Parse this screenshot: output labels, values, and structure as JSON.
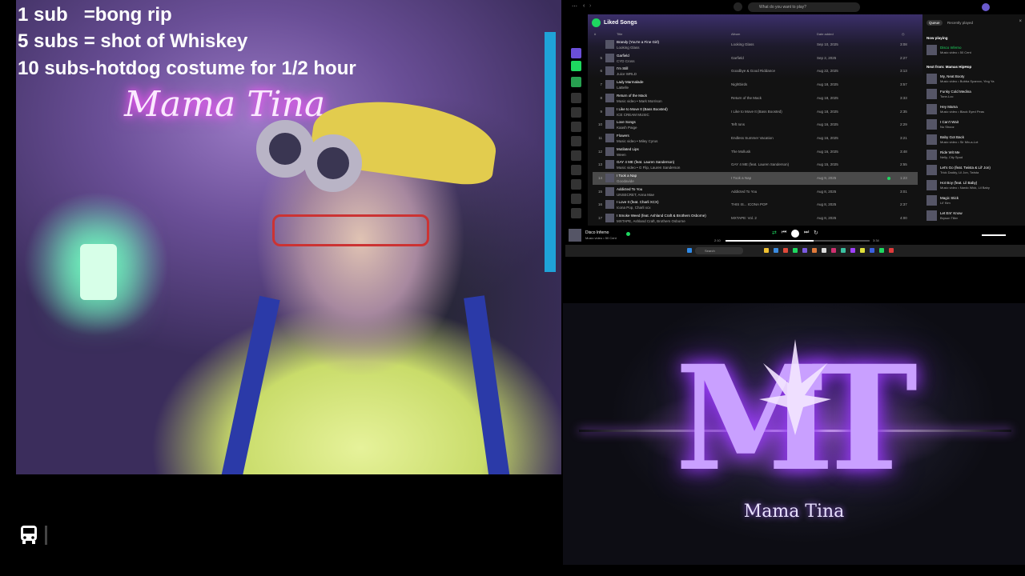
{
  "overlay": {
    "lines": [
      "1 sub   =bong rip",
      "5 subs = shot of Whiskey",
      "10 subs-hotdog costume for 1/2 hour"
    ]
  },
  "webcam": {
    "neon_sign": "Mama Tina"
  },
  "spotify": {
    "search_placeholder": "What do you want to play?",
    "playlist_title": "Liked Songs",
    "columns": {
      "num": "#",
      "title": "Title",
      "album": "Album",
      "date": "Date added"
    },
    "rows": [
      {
        "n": "",
        "title": "Brandy (You're a Fine Girl)",
        "artist": "Looking Glass",
        "album": "Looking Glass",
        "date": "Sep 10, 2025",
        "dur": "3:08"
      },
      {
        "n": "5",
        "title": "Garfield",
        "artist": "CYD Cross",
        "album": "Garfield",
        "date": "Sep 2, 2025",
        "dur": "2:27"
      },
      {
        "n": "6",
        "title": "I'm Still",
        "artist": "Juice WRLD",
        "album": "Goodbye & Good Riddance",
        "date": "Aug 22, 2025",
        "dur": "3:13"
      },
      {
        "n": "7",
        "title": "Lady Marmalade",
        "artist": "LaBelle",
        "album": "Nightbirds",
        "date": "Aug 18, 2025",
        "dur": "3:57"
      },
      {
        "n": "8",
        "title": "Return of the Mack",
        "artist": "Music video • Mark Morrison",
        "album": "Return of the Mack",
        "date": "Aug 18, 2025",
        "dur": "3:33"
      },
      {
        "n": "9",
        "title": "I Like to Move It (Bass Boosted)",
        "artist": "ICE CREAM MUSIC",
        "album": "I Like to Move It (Bass Boosted)",
        "date": "Aug 18, 2025",
        "dur": "2:35"
      },
      {
        "n": "10",
        "title": "Love Songs",
        "artist": "Kaash Paige",
        "album": "Teft Ions",
        "date": "Aug 16, 2025",
        "dur": "2:29"
      },
      {
        "n": "11",
        "title": "Flowers",
        "artist": "Music video • Miley Cyrus",
        "album": "Endless Summer Vacation",
        "date": "Aug 16, 2025",
        "dur": "3:21"
      },
      {
        "n": "12",
        "title": "Mutilated Lips",
        "artist": "Ween",
        "album": "The Mollusk",
        "date": "Aug 16, 2025",
        "dur": "3:48"
      },
      {
        "n": "13",
        "title": "GAY 4 ME (feat. Lauren Sanderson)",
        "artist": "Music video • G Flip, Lauren Sanderson",
        "album": "GAY 4 ME (feat. Lauren Sanderson)",
        "date": "Aug 15, 2025",
        "dur": "2:55"
      },
      {
        "n": "14",
        "title": "I Took a Nap",
        "artist": "Goodavide",
        "album": "I Took a Nap",
        "date": "Aug 9, 2025",
        "dur": "1:23"
      },
      {
        "n": "15",
        "title": "Addicted To You",
        "artist": "UNSECRET, Anna Mae",
        "album": "Addicted To You",
        "date": "Aug 8, 2025",
        "dur": "3:01"
      },
      {
        "n": "16",
        "title": "I Love It (feat. Charli XCX)",
        "artist": "Icona Pop, Charli xcx",
        "album": "THIS IS... ICONA POP",
        "date": "Aug 8, 2025",
        "dur": "2:37"
      },
      {
        "n": "17",
        "title": "I Smoke Weed (feat. Ashland Craft & Brothers Osborne)",
        "artist": "MXTAPE, Ashland Craft, Brothers Osborne",
        "album": "MXTAPE: Vol. 2",
        "date": "Aug 8, 2025",
        "dur": "4:00"
      }
    ],
    "queue": {
      "tabs": [
        "Queue",
        "Recently played"
      ],
      "now_playing_label": "Now playing",
      "now_playing": {
        "title": "Disco Inferno",
        "artist": "Music video • 50 Cent"
      },
      "next_from_label": "Next from: Mamas HipHop",
      "items": [
        {
          "title": "My, Neat Booty",
          "artist": "Music video • Bubba Sparxxx, Ying Ya"
        },
        {
          "title": "Funky Cold Medina",
          "artist": "Tone-Loc"
        },
        {
          "title": "Hey Mama",
          "artist": "Music video • Black Eyed Peas"
        },
        {
          "title": "I Can't Wait",
          "artist": "Nu Shooz"
        },
        {
          "title": "Baby Got Back",
          "artist": "Music video • Sir Mix-a-Lot"
        },
        {
          "title": "Ride Wit Me",
          "artist": "Nelly, City Spud"
        },
        {
          "title": "Let's Go (feat. Twista & Lil' Jon)",
          "artist": "Trick Daddy, Lil Jon, Twista"
        },
        {
          "title": "Hot Boy (feat. Lil Baby)",
          "artist": "Music video • Nardo Wick, Lil Baby"
        },
        {
          "title": "Magic Stick",
          "artist": "Lil' Kim"
        },
        {
          "title": "Let Em' Know",
          "artist": "Bryson Tiller"
        }
      ]
    },
    "player": {
      "track": "Disco Inferno",
      "artist": "Music video • 50 Cent",
      "elapsed": "2:10",
      "total": "3:34",
      "progress": 0.61
    },
    "taskbar": {
      "search": "Search"
    }
  },
  "logo": {
    "monogram": "MT",
    "name": "Mama Tina"
  }
}
